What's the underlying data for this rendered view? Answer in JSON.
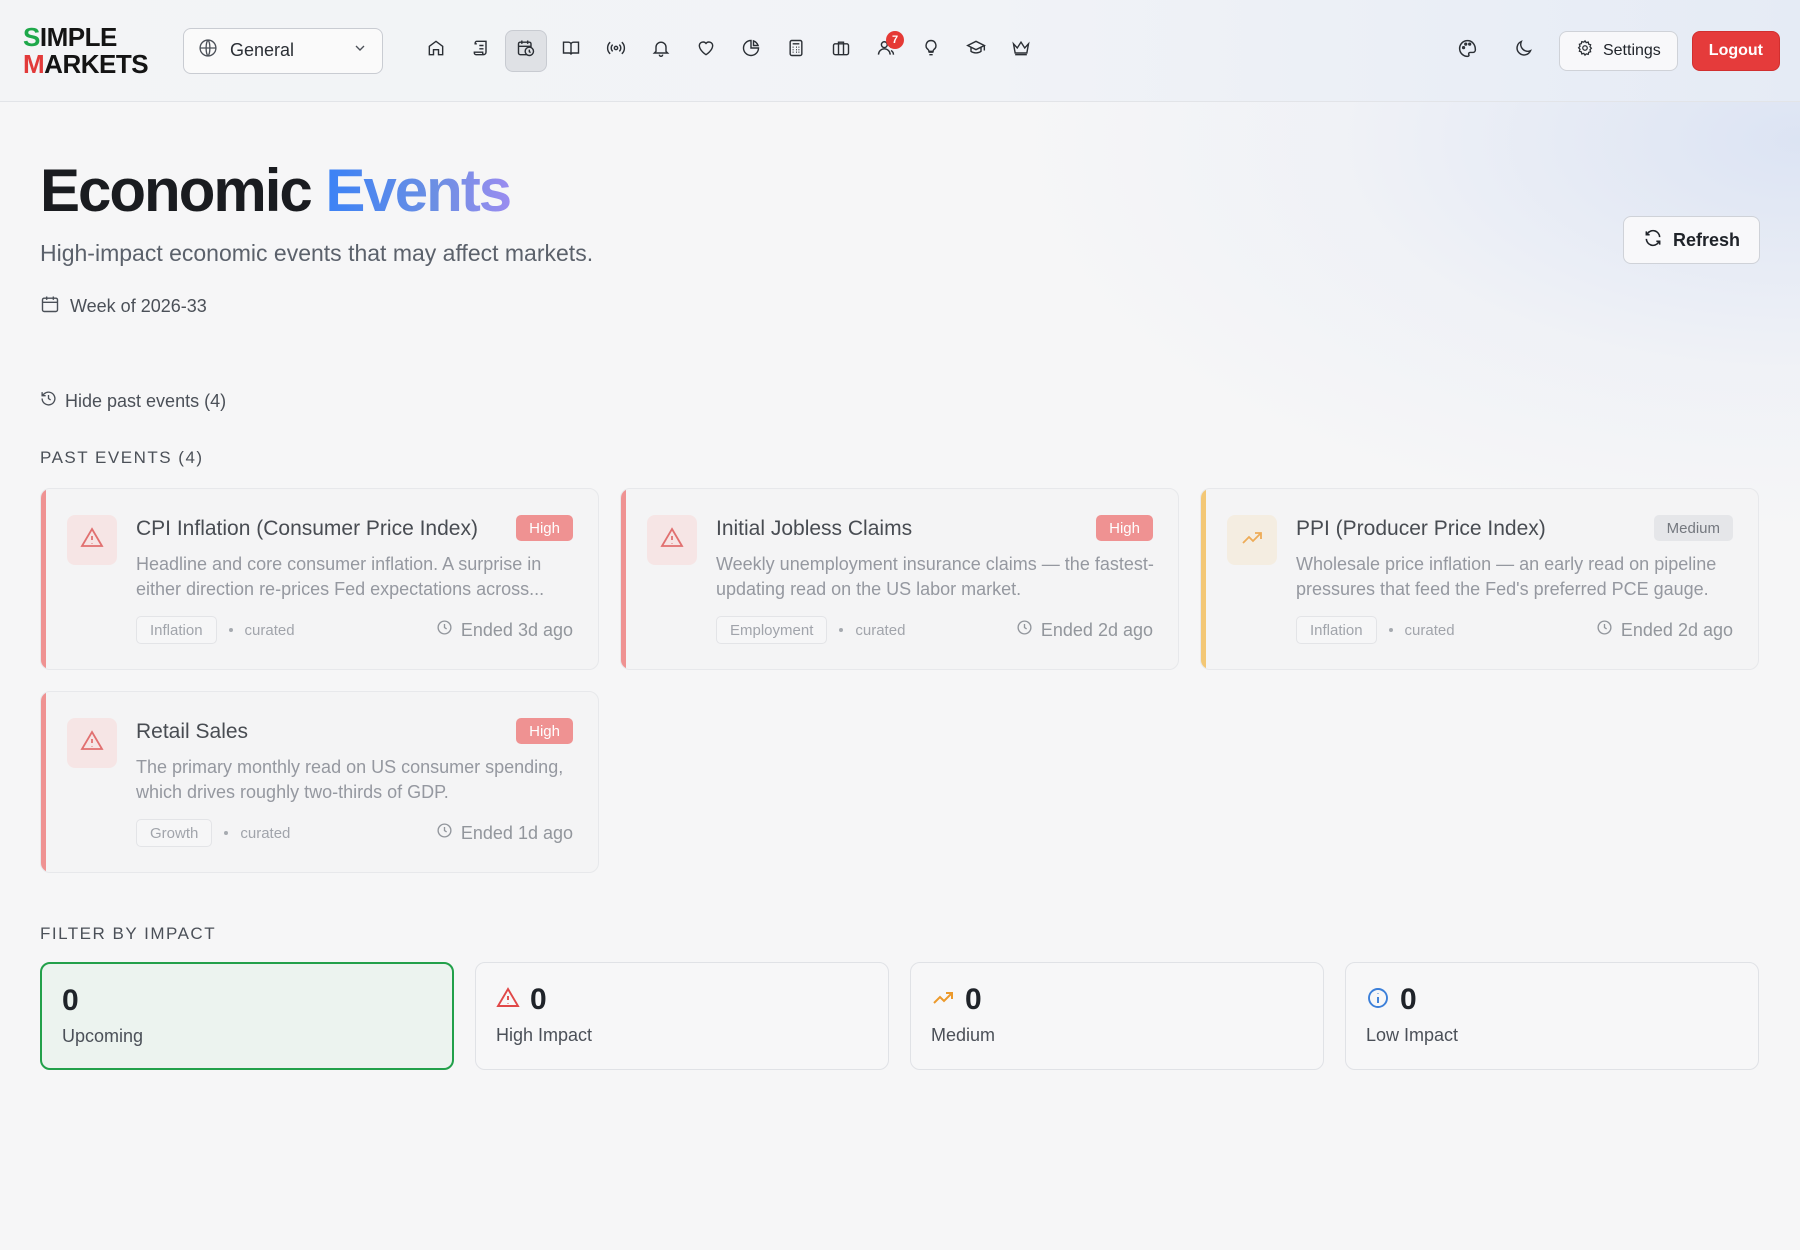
{
  "logo": {
    "line1_first": "S",
    "line1_rest": "IMPLE",
    "line2_first": "M",
    "line2_rest": "ARKETS"
  },
  "header": {
    "category_select": "General",
    "nav_icons": [
      "home-icon",
      "scroll-icon",
      "calendar-clock-icon",
      "book-open-icon",
      "broadcast-icon",
      "bell-icon",
      "heart-icon",
      "pie-chart-icon",
      "calculator-icon",
      "briefcase-icon",
      "users-icon",
      "lightbulb-icon",
      "graduation-cap-icon",
      "crown-icon"
    ],
    "active_nav": "calendar-clock-icon",
    "users_badge": "7",
    "settings_label": "Settings",
    "logout_label": "Logout"
  },
  "page": {
    "title_main": "Economic",
    "title_accent": "Events",
    "subtitle": "High-impact economic events that may affect markets.",
    "week": "Week of 2026-33",
    "refresh_label": "Refresh",
    "hide_past_label": "Hide past events (4)",
    "past_events_label": "PAST EVENTS (4)",
    "filter_label": "FILTER BY IMPACT"
  },
  "colors": {
    "high": "#ef8a8a",
    "medium": "#f3c46a",
    "active_filter": "#22a04a",
    "accent_blue": "#3b82f6"
  },
  "past_events": [
    {
      "title": "CPI Inflation (Consumer Price Index)",
      "impact": "High",
      "impact_level": "high",
      "description": "Headline and core consumer inflation. A surprise in either direction re-prices Fed expectations across...",
      "tag": "Inflation",
      "source": "curated",
      "status": "Ended 3d ago",
      "icon": "alert-triangle-icon"
    },
    {
      "title": "Initial Jobless Claims",
      "impact": "High",
      "impact_level": "high",
      "description": "Weekly unemployment insurance claims — the fastest-updating read on the US labor market.",
      "tag": "Employment",
      "source": "curated",
      "status": "Ended 2d ago",
      "icon": "alert-triangle-icon"
    },
    {
      "title": "PPI (Producer Price Index)",
      "impact": "Medium",
      "impact_level": "medium",
      "description": "Wholesale price inflation — an early read on pipeline pressures that feed the Fed's preferred PCE gauge.",
      "tag": "Inflation",
      "source": "curated",
      "status": "Ended 2d ago",
      "icon": "trending-up-icon"
    },
    {
      "title": "Retail Sales",
      "impact": "High",
      "impact_level": "high",
      "description": "The primary monthly read on US consumer spending, which drives roughly two-thirds of GDP.",
      "tag": "Growth",
      "source": "curated",
      "status": "Ended 1d ago",
      "icon": "alert-triangle-icon"
    }
  ],
  "filters": [
    {
      "count": "0",
      "label": "Upcoming",
      "icon": "",
      "active": true
    },
    {
      "count": "0",
      "label": "High Impact",
      "icon": "alert-triangle-icon",
      "active": false
    },
    {
      "count": "0",
      "label": "Medium",
      "icon": "trending-up-icon",
      "active": false
    },
    {
      "count": "0",
      "label": "Low Impact",
      "icon": "info-icon",
      "active": false
    }
  ]
}
